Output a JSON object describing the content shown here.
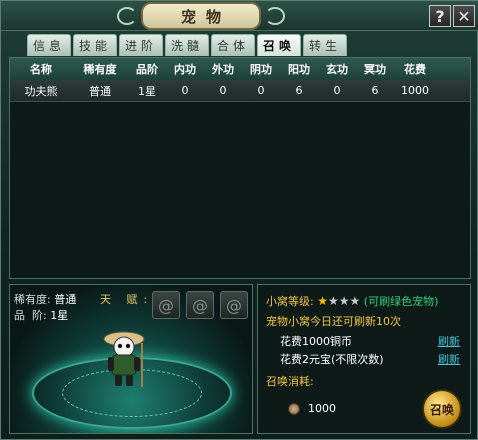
{
  "window": {
    "title": "宠物",
    "help": "?",
    "close": "✕"
  },
  "tabs": [
    "信息",
    "技能",
    "进阶",
    "洗髓",
    "合体",
    "召唤",
    "转生"
  ],
  "table": {
    "headers": [
      "名称",
      "稀有度",
      "品阶",
      "内功",
      "外功",
      "阴功",
      "阳功",
      "玄功",
      "冥功",
      "花费"
    ],
    "rows": [
      [
        "功夫熊",
        "普通",
        "1星",
        "0",
        "0",
        "0",
        "6",
        "0",
        "6",
        "1000"
      ]
    ]
  },
  "preview": {
    "rarity_label": "稀有度:",
    "rarity_value": "普通",
    "grade_label": "品  阶:",
    "grade_value": "1星",
    "talent_label": "天  赋:"
  },
  "info": {
    "nest_level_label": "小窝等级:",
    "nest_stars_filled": 1,
    "nest_stars_total": 4,
    "nest_note": "(可刷绿色宠物)",
    "refresh_remaining": "宠物小窝今日还可刷新10次",
    "cost_copper": "花费1000铜币",
    "cost_yuanbao": "花费2元宝(不限次数)",
    "refresh_link": "刷新",
    "summon_cost_label": "召唤消耗:",
    "summon_cost_value": "1000",
    "summon_button": "召唤"
  },
  "colors": {
    "accent_gold": "#f0c64a",
    "accent_green": "#2fd07a",
    "link": "#43c7d9"
  }
}
